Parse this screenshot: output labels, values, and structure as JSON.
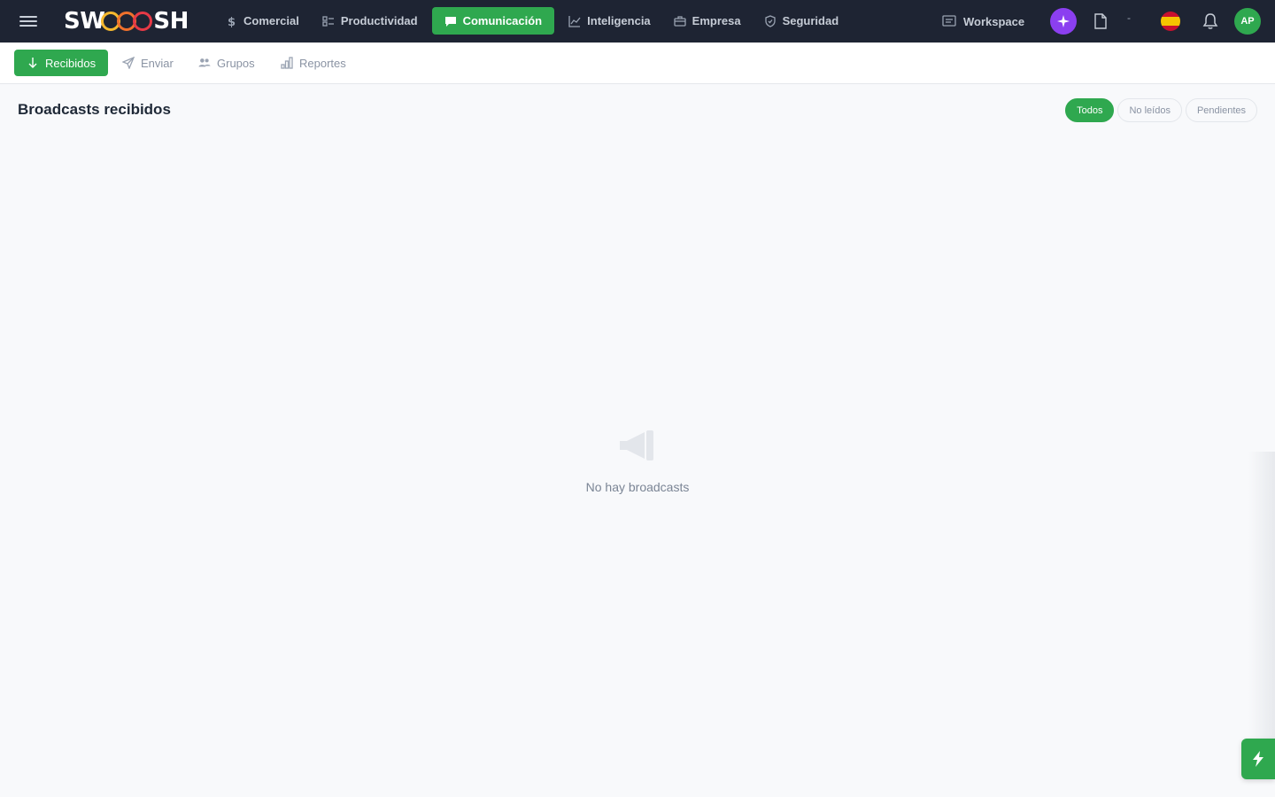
{
  "brand": {
    "name": "SWOOOSH",
    "colors": {
      "nav_bg": "#1e2433",
      "accent": "#2fa84f",
      "ai": "#8b3ff0"
    }
  },
  "topnav": {
    "items": [
      {
        "label": "Comercial",
        "icon": "dollar-icon",
        "active": false
      },
      {
        "label": "Productividad",
        "icon": "checklist-icon",
        "active": false
      },
      {
        "label": "Comunicación",
        "icon": "chat-icon",
        "active": true
      },
      {
        "label": "Inteligencia",
        "icon": "chart-line-icon",
        "active": false
      },
      {
        "label": "Empresa",
        "icon": "briefcase-icon",
        "active": false
      },
      {
        "label": "Seguridad",
        "icon": "shield-icon",
        "active": false
      }
    ],
    "workspace_label": "Workspace",
    "separator": "-",
    "avatar_initials": "AP",
    "language_icon": "spain-flag-icon"
  },
  "subnav": {
    "items": [
      {
        "label": "Recibidos",
        "icon": "arrow-down-icon",
        "active": true
      },
      {
        "label": "Enviar",
        "icon": "send-icon",
        "active": false
      },
      {
        "label": "Grupos",
        "icon": "users-icon",
        "active": false
      },
      {
        "label": "Reportes",
        "icon": "bar-chart-icon",
        "active": false
      }
    ]
  },
  "page": {
    "title": "Broadcasts recibidos",
    "filters": [
      {
        "label": "Todos",
        "active": true
      },
      {
        "label": "No leídos",
        "active": false
      },
      {
        "label": "Pendientes",
        "active": false
      }
    ],
    "empty_message": "No hay broadcasts",
    "empty_icon": "megaphone-icon"
  },
  "fab": {
    "icon": "lightning-icon"
  }
}
